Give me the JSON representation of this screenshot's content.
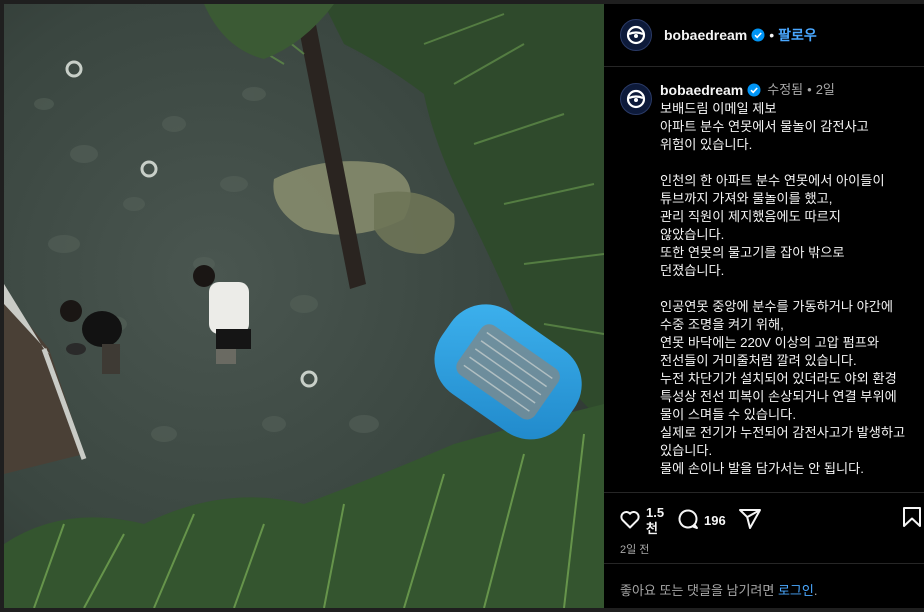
{
  "account": {
    "username": "bobaedream",
    "follow_label": "팔로우",
    "dot": "•"
  },
  "caption": {
    "username": "bobaedream",
    "edited_label": "수정됨",
    "dot": "•",
    "time": "2일",
    "text": "보배드림 이메일 제보\n아파트 분수 연못에서 물놀이 감전사고 위험이 있습니다.\n\n인천의 한 아파트 분수 연못에서 아이들이 튜브까지 가져와 물놀이를 했고,\n관리 직원이 제지했음에도 따르지 않았습니다.\n또한 연못의 물고기를 잡아 밖으로 던졌습니다.\n\n인공연못 중앙에 분수를 가동하거나 야간에 수중 조명을 켜기 위해,\n연못 바닥에는 220V 이상의 고압 펌프와 전선들이 거미줄처럼 깔려 있습니다.\n누전 차단기가 설치되어 있더라도 야외 환경 특성상 전선 피복이 손상되거나 연결 부위에 물이 스며들 수 있습니다.\n실제로 전기가 누전되어 감전사고가 발생하고 있습니다.\n물에 손이나 발을 담가서는 안 됩니다."
  },
  "actions": {
    "like_count": "1.5천",
    "comment_count": "196"
  },
  "post_date": "2일 전",
  "login_prompt": {
    "text": "좋아요 또는 댓글을 남기려면 ",
    "link": "로그인",
    "suffix": "."
  },
  "colors": {
    "accent": "#4aa8ff",
    "verified": "#0095f6",
    "muted": "#a8a8a8",
    "background": "#000000"
  },
  "icons": [
    "steering-wheel-logo-icon",
    "verified-badge-icon",
    "heart-icon",
    "comment-icon",
    "share-icon",
    "bookmark-icon"
  ]
}
